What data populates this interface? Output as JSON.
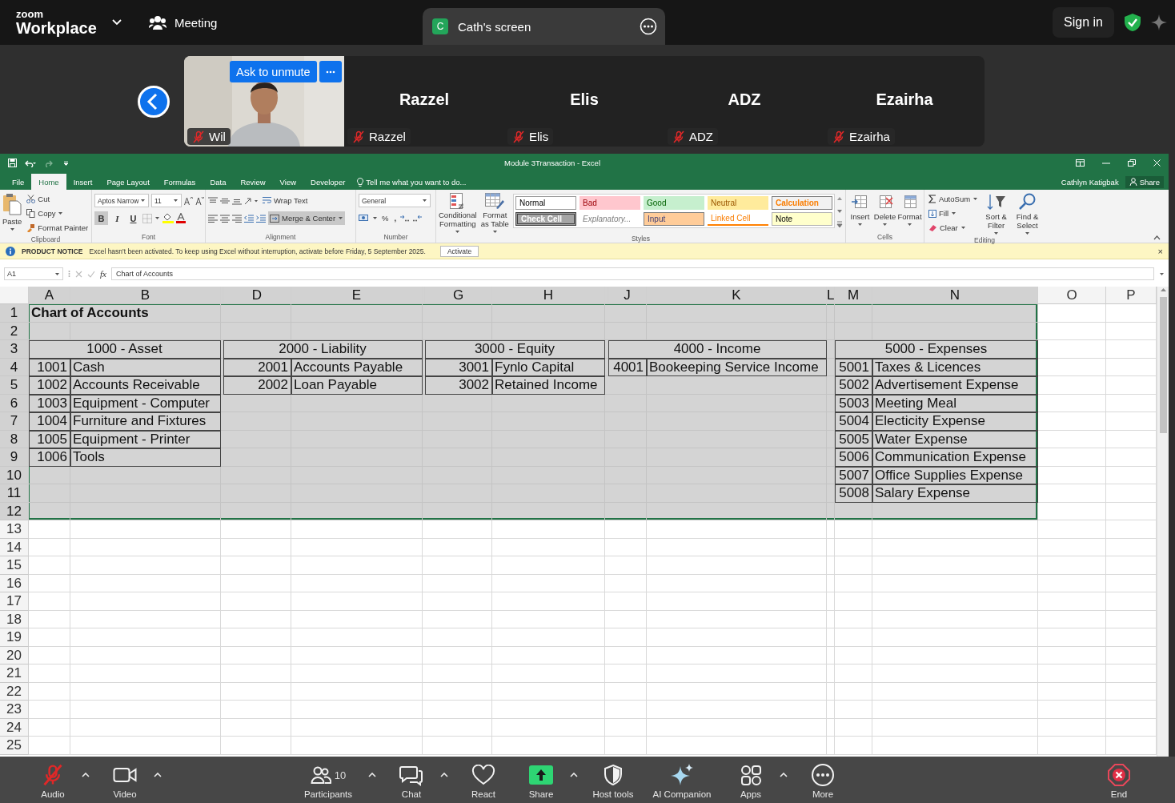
{
  "top_bar": {
    "brand_small": "zoom",
    "brand": "Workplace",
    "meeting": "Meeting",
    "share_tab": {
      "badge": "C",
      "title": "Cath's screen"
    },
    "sign_in": "Sign in"
  },
  "strip": {
    "ask_unmute": "Ask to unmute",
    "participants": [
      {
        "name": "Wil",
        "kind": "video",
        "muted": true
      },
      {
        "name": "Razzel",
        "display_name": "Razzel",
        "kind": "name",
        "muted": true
      },
      {
        "name": "Elis",
        "display_name": "Elis",
        "kind": "name",
        "muted": true
      },
      {
        "name": "ADZ",
        "display_name": "ADZ",
        "kind": "name",
        "muted": true
      },
      {
        "name": "Ezairha",
        "display_name": "Ezairha",
        "kind": "name",
        "muted": true
      }
    ]
  },
  "excel": {
    "title": "Module 3Transaction - Excel",
    "tabs": [
      {
        "label": "File",
        "selected": false
      },
      {
        "label": "Home",
        "selected": true
      },
      {
        "label": "Insert",
        "selected": false
      },
      {
        "label": "Page Layout",
        "selected": false
      },
      {
        "label": "Formulas",
        "selected": false
      },
      {
        "label": "Data",
        "selected": false
      },
      {
        "label": "Review",
        "selected": false
      },
      {
        "label": "View",
        "selected": false
      },
      {
        "label": "Developer",
        "selected": false
      }
    ],
    "tell_me": "Tell me what you want to do...",
    "user": "Cathlyn Katigbak",
    "share": "Share",
    "ribbon": {
      "clipboard": {
        "label": "Clipboard",
        "paste": "Paste",
        "cut": "Cut",
        "copy": "Copy",
        "painter": "Format Painter"
      },
      "font": {
        "label": "Font",
        "family": "Aptos Narrow",
        "size": "11",
        "styles": [
          {
            "label": "B",
            "kind": "bold",
            "selected": true
          },
          {
            "label": "I",
            "kind": "italic",
            "selected": false
          },
          {
            "label": "U",
            "kind": "underline",
            "selected": false
          }
        ]
      },
      "alignment": {
        "label": "Alignment",
        "wrap": "Wrap Text",
        "merge": {
          "label": "Merge & Center",
          "selected": true
        }
      },
      "number": {
        "label": "Number",
        "format": "General",
        "percent": "%",
        "comma": ","
      },
      "styles": {
        "label": "Styles",
        "conditional": "Conditional Formatting",
        "table": "Format as Table",
        "gallery": [
          {
            "label": "Normal",
            "kind": "normal"
          },
          {
            "label": "Bad",
            "kind": "bad"
          },
          {
            "label": "Good",
            "kind": "good"
          },
          {
            "label": "Neutral",
            "kind": "neutral"
          },
          {
            "label": "Calculation",
            "kind": "calculation"
          },
          {
            "label": "Check Cell",
            "kind": "check"
          },
          {
            "label": "Explanatory...",
            "kind": "explanatory"
          },
          {
            "label": "Input",
            "kind": "input"
          },
          {
            "label": "Linked Cell",
            "kind": "linked"
          },
          {
            "label": "Note",
            "kind": "note"
          }
        ]
      },
      "cells": {
        "label": "Cells",
        "buttons": [
          "Insert",
          "Delete",
          "Format"
        ]
      },
      "editing": {
        "label": "Editing",
        "autosum": "AutoSum",
        "fill": "Fill",
        "clear": "Clear",
        "sort": "Sort & Filter",
        "find": "Find & Select"
      }
    },
    "notice": {
      "heading": "PRODUCT NOTICE",
      "message": "Excel hasn't been activated. To keep using Excel without interruption, activate before Friday, 5 September 2025.",
      "button": "Activate",
      "close": "×"
    },
    "formula_bar": {
      "name_box": "A1",
      "fx": "fx",
      "content": "Chart of Accounts"
    },
    "sheet": {
      "title": "Chart of Accounts",
      "columns": [
        {
          "label": "A",
          "selected": true
        },
        {
          "label": "B",
          "selected": true
        },
        {
          "selected": true
        },
        {
          "label": "D",
          "selected": true
        },
        {
          "label": "E",
          "selected": true
        },
        {
          "selected": true
        },
        {
          "label": "G",
          "selected": true
        },
        {
          "label": "H",
          "selected": true
        },
        {
          "selected": true
        },
        {
          "label": "J",
          "selected": true
        },
        {
          "label": "K",
          "selected": true
        },
        {
          "label": "L",
          "selected": true
        },
        {
          "label": "M",
          "selected": true
        },
        {
          "label": "N",
          "selected": true
        },
        {
          "label": "O",
          "selected": false
        },
        {
          "label": "P",
          "selected": false
        }
      ],
      "rows": [
        {
          "label": "1",
          "selected": true
        },
        {
          "label": "2",
          "selected": true
        },
        {
          "label": "3",
          "selected": true
        },
        {
          "label": "4",
          "selected": true
        },
        {
          "label": "5",
          "selected": true
        },
        {
          "label": "6",
          "selected": true
        },
        {
          "label": "7",
          "selected": true
        },
        {
          "label": "8",
          "selected": true
        },
        {
          "label": "9",
          "selected": true
        },
        {
          "label": "10",
          "selected": true
        },
        {
          "label": "11",
          "selected": true
        },
        {
          "label": "12",
          "selected": true
        },
        {
          "label": "13",
          "selected": false
        },
        {
          "label": "14",
          "selected": false
        },
        {
          "label": "15",
          "selected": false
        },
        {
          "label": "16",
          "selected": false
        },
        {
          "label": "17",
          "selected": false
        },
        {
          "label": "18",
          "selected": false
        },
        {
          "label": "19",
          "selected": false
        },
        {
          "label": "20",
          "selected": false
        },
        {
          "label": "21",
          "selected": false
        },
        {
          "label": "22",
          "selected": false
        },
        {
          "label": "23",
          "selected": false
        },
        {
          "label": "24",
          "selected": false
        },
        {
          "label": "25",
          "selected": false
        }
      ],
      "groups": [
        {
          "heading": "1000 - Asset",
          "accounts": [
            {
              "code": "1001",
              "name": "Cash"
            },
            {
              "code": "1002",
              "name": "Accounts Receivable"
            },
            {
              "code": "1003",
              "name": "Equipment - Computer"
            },
            {
              "code": "1004",
              "name": "Furniture and Fixtures"
            },
            {
              "code": "1005",
              "name": "Equipment - Printer"
            },
            {
              "code": "1006",
              "name": "Tools"
            }
          ]
        },
        {
          "heading": "2000 - Liability",
          "accounts": [
            {
              "code": "2001",
              "name": "Accounts Payable"
            },
            {
              "code": "2002",
              "name": "Loan Payable"
            }
          ]
        },
        {
          "heading": "3000 - Equity",
          "accounts": [
            {
              "code": "3001",
              "name": "Fynlo Capital"
            },
            {
              "code": "3002",
              "name": "Retained Income"
            }
          ]
        },
        {
          "heading": "4000 - Income",
          "accounts": [
            {
              "code": "4001",
              "name": "Bookeeping Service Income"
            }
          ]
        },
        {
          "heading": "5000 - Expenses",
          "accounts": [
            {
              "code": "5001",
              "name": "Taxes & Licences"
            },
            {
              "code": "5002",
              "name": "Advertisement Expense"
            },
            {
              "code": "5003",
              "name": "Meeting Meal"
            },
            {
              "code": "5004",
              "name": "Electicity Expense"
            },
            {
              "code": "5005",
              "name": "Water Expense"
            },
            {
              "code": "5006",
              "name": "Communication Expense"
            },
            {
              "code": "5007",
              "name": "Office Supplies Expense"
            },
            {
              "code": "5008",
              "name": "Salary Expense"
            }
          ]
        }
      ]
    }
  },
  "toolbar": [
    {
      "label": "Audio",
      "kind": "audio",
      "muted": true,
      "menu": true
    },
    {
      "label": "Video",
      "kind": "video",
      "menu": true
    },
    {
      "label": "Participants",
      "kind": "participants",
      "count": "10",
      "menu": true
    },
    {
      "label": "Chat",
      "kind": "chat",
      "menu": true
    },
    {
      "label": "React",
      "kind": "react",
      "menu": false
    },
    {
      "label": "Share",
      "kind": "share",
      "menu": true
    },
    {
      "label": "Host tools",
      "kind": "host",
      "menu": false
    },
    {
      "label": "AI Companion",
      "kind": "ai",
      "menu": false
    },
    {
      "label": "Apps",
      "kind": "apps",
      "menu": true
    },
    {
      "label": "More",
      "kind": "more",
      "menu": false
    },
    {
      "label": "End",
      "kind": "end",
      "menu": false
    }
  ]
}
